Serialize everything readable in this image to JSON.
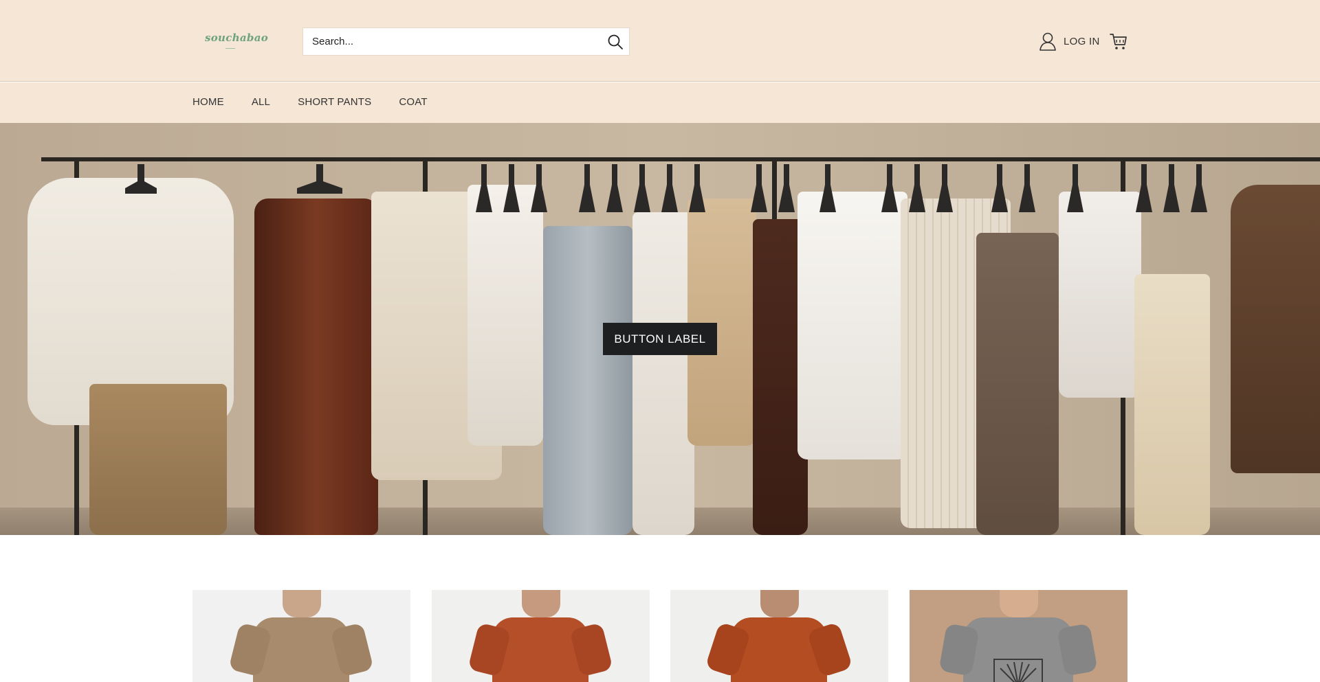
{
  "header": {
    "logo_text": "souchabao",
    "search": {
      "placeholder": "Search..."
    },
    "account_label": "LOG IN",
    "icons": {
      "search": "search-icon",
      "account": "user-icon",
      "cart": "cart-icon"
    }
  },
  "nav": {
    "items": [
      {
        "label": "HOME"
      },
      {
        "label": "ALL"
      },
      {
        "label": "SHORT PANTS"
      },
      {
        "label": "COAT"
      }
    ]
  },
  "hero": {
    "button_label": "BUTTON LABEL"
  },
  "products": [
    {
      "color": "#a88a6c",
      "bg": "#f1f1f1"
    },
    {
      "color": "#b44f2a",
      "bg": "#f0f0ef"
    },
    {
      "color": "#b54d22",
      "bg": "#efefee"
    },
    {
      "color": "#8e8e8e",
      "bg": "#c29f82"
    }
  ],
  "colors": {
    "header_bg": "#f5e6d6",
    "logo": "#6fa37e",
    "button_bg": "#1e1f21",
    "text": "#333333"
  }
}
